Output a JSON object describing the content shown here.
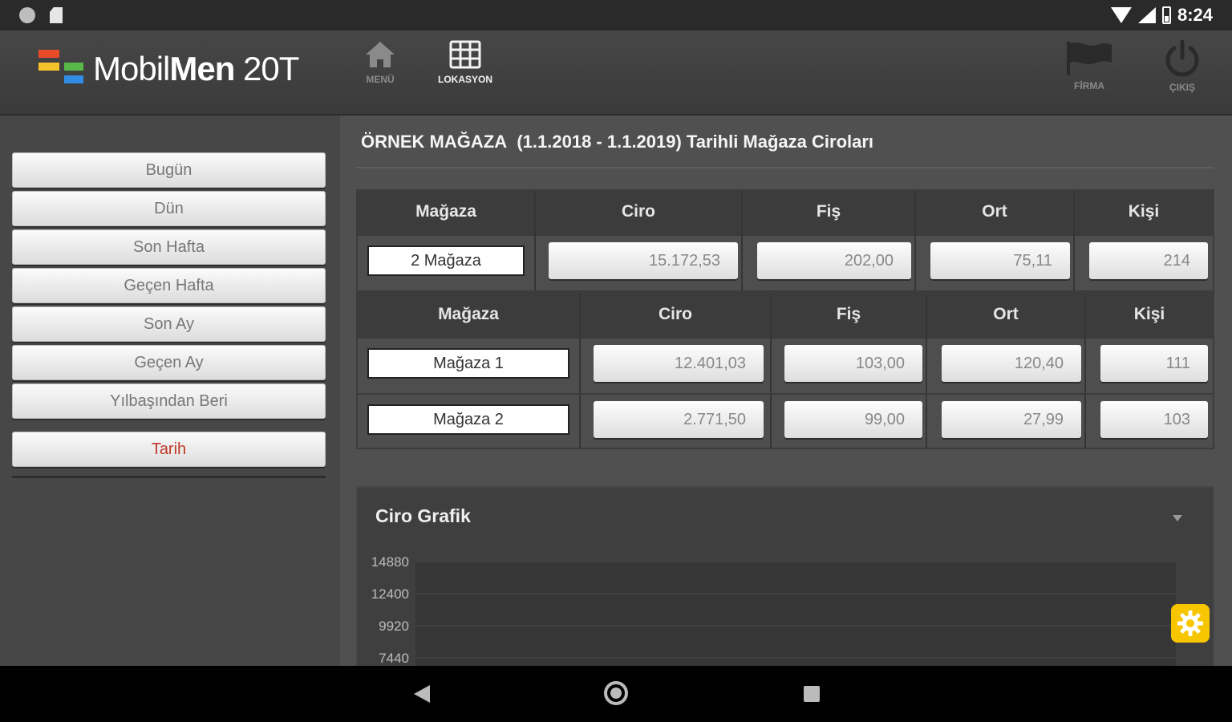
{
  "status_bar": {
    "time": "8:24"
  },
  "app": {
    "logo_text_light": "Mobil",
    "logo_text_bold": "Men",
    "logo_text_suffix": " 20T"
  },
  "nav": {
    "menu": "MENÜ",
    "lokasyon": "LOKASYON",
    "firma": "FİRMA",
    "cikis": "ÇIKIŞ"
  },
  "sidebar": {
    "items": [
      {
        "label": "Bugün"
      },
      {
        "label": "Dün"
      },
      {
        "label": "Son Hafta"
      },
      {
        "label": "Geçen Hafta"
      },
      {
        "label": "Son Ay"
      },
      {
        "label": "Geçen Ay"
      },
      {
        "label": "Yılbaşından Beri"
      }
    ],
    "date_button": "Tarih"
  },
  "main": {
    "store_name": "ÖRNEK MAĞAZA",
    "title_rest": "(1.1.2018 - 1.1.2019) Tarihli Mağaza Ciroları"
  },
  "summary_table": {
    "headers": [
      "Mağaza",
      "Ciro",
      "Fiş",
      "Ort",
      "Kişi"
    ],
    "row": {
      "magaza": "2 Mağaza",
      "ciro": "15.172,53",
      "fis": "202,00",
      "ort": "75,11",
      "kisi": "214"
    }
  },
  "detail_table": {
    "headers": [
      "Mağaza",
      "Ciro",
      "Fiş",
      "Ort",
      "Kişi"
    ],
    "rows": [
      {
        "magaza": "Mağaza 1",
        "ciro": "12.401,03",
        "fis": "103,00",
        "ort": "120,40",
        "kisi": "111"
      },
      {
        "magaza": "Mağaza 2",
        "ciro": "2.771,50",
        "fis": "99,00",
        "ort": "27,99",
        "kisi": "103"
      }
    ]
  },
  "chart": {
    "title": "Ciro Grafik"
  },
  "chart_data": {
    "type": "bar",
    "title": "Ciro Grafik",
    "yticks": [
      "14880",
      "12400",
      "9920",
      "7440"
    ],
    "ylim": [
      7440,
      14880
    ],
    "grid": true
  },
  "colors": {
    "accent": "#f7c600",
    "red_button_text": "#c0392b"
  }
}
